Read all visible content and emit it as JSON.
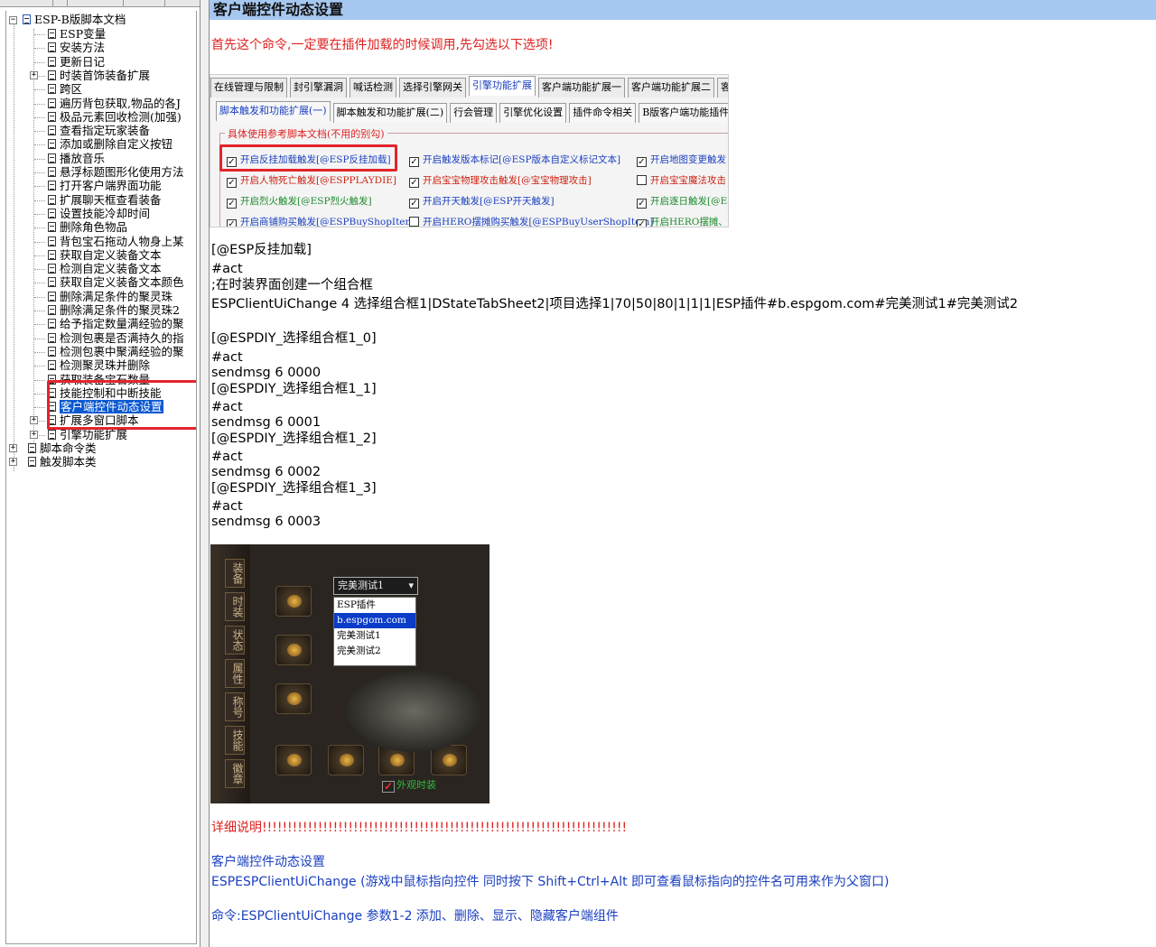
{
  "tree": {
    "root": "ESP-B版脚本文档",
    "items": [
      "ESP变量",
      "安装方法",
      "更新日记",
      "时装首饰装备扩展",
      "跨区",
      "遍历背包获取,物品的各J",
      "极品元素回收检测(加强)",
      "查看指定玩家装备",
      "添加或删除自定义按钮",
      "播放音乐",
      "悬浮标题图形化使用方法",
      "打开客户端界面功能",
      "扩展聊天框查看装备",
      "设置技能冷却时间",
      "删除角色物品",
      "背包宝石拖动人物身上某",
      "获取自定义装备文本",
      "检测自定义装备文本",
      "获取自定义装备文本颜色",
      "删除满足条件的聚灵珠",
      "删除满足条件的聚灵珠2",
      "给予指定数量满经验的聚",
      "检测包裹是否满持久的指",
      "检测包裹中聚满经验的聚",
      "检测聚灵珠并删除",
      "获取装备宝石数量",
      "技能控制和中断技能",
      "客户端控件动态设置",
      "扩展多窗口脚本",
      "引擎功能扩展"
    ],
    "bottom": [
      "脚本命令类",
      "触发脚本类"
    ]
  },
  "doc": {
    "title": "客户端控件动态设置",
    "intro": "首先这个命令,一定要在插件加载的时候调用,先勾选以下选项!",
    "tabs1": [
      "在线管理与限制",
      "封引擎漏洞",
      "喊话检测",
      "选择引擎网关",
      "引擎功能扩展",
      "客户端功能扩展一",
      "客户端功能扩展二",
      "客户端"
    ],
    "tabs2": [
      "脚本触发和功能扩展(一)",
      "脚本触发和功能扩展(二)",
      "行会管理",
      "引擎优化设置",
      "插件命令相关",
      "B版客户端功能插件"
    ],
    "group_label": "具体使用参考脚本文档(不用的别勾)",
    "checks": [
      "开启反挂加载触发[@ESP反挂加载]",
      "开启触发版本标记[@ESP版本自定义标记文本]",
      "开启地图变更触发",
      "开启人物死亡触发[@ESPPLAYDIE]",
      "开启宝宝物理攻击触发[@宝宝物理攻击]",
      "开启宝宝魔法攻击",
      "开启烈火触发[@ESP烈火触发]",
      "开启开天触发[@ESP开天触发]",
      "开启逐日触发[@ES",
      "开启商铺购买触发[@ESPBuyShopItem]",
      "开启HERO摆摊购买触发[@ESPBuyUserShopItem]",
      "开启HERO摆摊、个"
    ],
    "code_lines": [
      "[@ESP反挂加载]",
      "#act",
      ";在时装界面创建一个组合框",
      "ESPClientUiChange 4 选择组合框1|DStateTabSheet2|项目选择1|70|50|80|1|1|1|ESP插件#b.espgom.com#完美测试1#完美测试2",
      "[@ESPDIY_选择组合框1_0]",
      "#act",
      "sendmsg 6 0000",
      "[@ESPDIY_选择组合框1_1]",
      "#act",
      "sendmsg 6 0001",
      "[@ESPDIY_选择组合框1_2]",
      "#act",
      "sendmsg 6 0002",
      "[@ESPDIY_选择组合框1_3]",
      "#act",
      "sendmsg 6 0003"
    ],
    "game": {
      "side_tabs": [
        "装备",
        "时装",
        "状态",
        "属性",
        "称号",
        "技能",
        "徽章"
      ],
      "combo_value": "完美测试1",
      "combo_options": [
        "ESP插件",
        "b.espgom.com",
        "完美测试1",
        "完美测试2"
      ],
      "checkbox_label": "外观时装"
    },
    "detail": "详细说明!!!!!!!!!!!!!!!!!!!!!!!!!!!!!!!!!!!!!!!!!!!!!!!!!!!!!!!!!!!!!!!!!!!!!!!!",
    "link_title": "客户端控件动态设置",
    "link_desc": "ESPESPClientUiChange (游戏中鼠标指向控件 同时按下 Shift+Ctrl+Alt 即可查看鼠标指向的控件名可用来作为父窗口)",
    "command": "命令:ESPClientUiChange 参数1-2 添加、删除、显示、隐藏客户端组件"
  }
}
